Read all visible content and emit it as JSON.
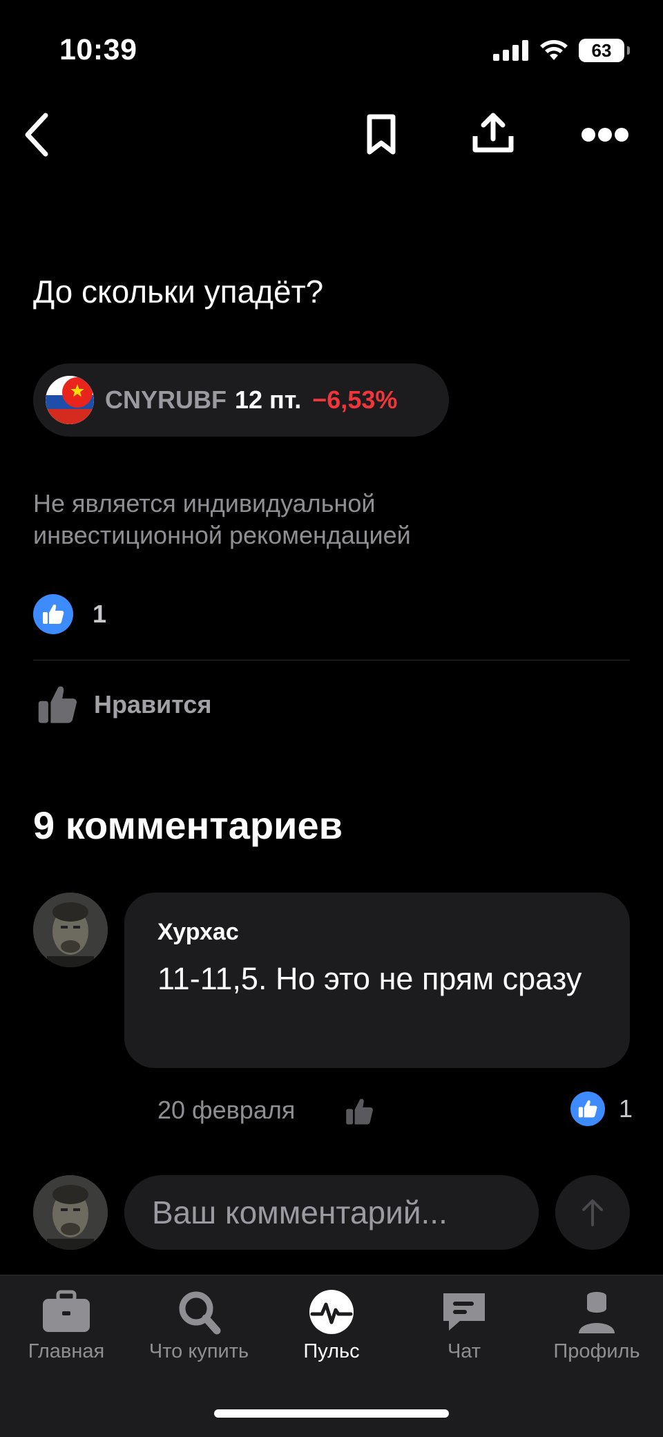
{
  "status_bar": {
    "time": "10:39",
    "battery": "63"
  },
  "nav": {
    "back_icon": "chevron-left-icon",
    "bookmark_icon": "bookmark-icon",
    "share_icon": "share-icon",
    "more_icon": "more-icon"
  },
  "post": {
    "title": "До скольки упадёт?",
    "ticker": {
      "name": "CNYRUBF",
      "period": "12 пт.",
      "change": "−6,53%",
      "change_color": "#f0363a"
    },
    "disclaimer": "Не является индивидуальной инвестиционной рекомендацией",
    "likes_count": "1",
    "like_action_label": "Нравится"
  },
  "comments": {
    "heading": "9 комментариев",
    "items": [
      {
        "author": "Хурхас",
        "text": "11-11,5. Но это не прям сразу",
        "date": "20 февраля",
        "likes": "1"
      }
    ],
    "input_placeholder": "Ваш комментарий..."
  },
  "tabbar": {
    "items": [
      {
        "label": "Главная",
        "icon": "briefcase-icon"
      },
      {
        "label": "Что купить",
        "icon": "search-icon"
      },
      {
        "label": "Пульс",
        "icon": "pulse-icon",
        "active": true
      },
      {
        "label": "Чат",
        "icon": "chat-icon"
      },
      {
        "label": "Профиль",
        "icon": "profile-icon"
      }
    ]
  },
  "colors": {
    "accent_blue": "#3d8bfd",
    "negative_red": "#f0363a",
    "surface": "#1c1c1e"
  }
}
